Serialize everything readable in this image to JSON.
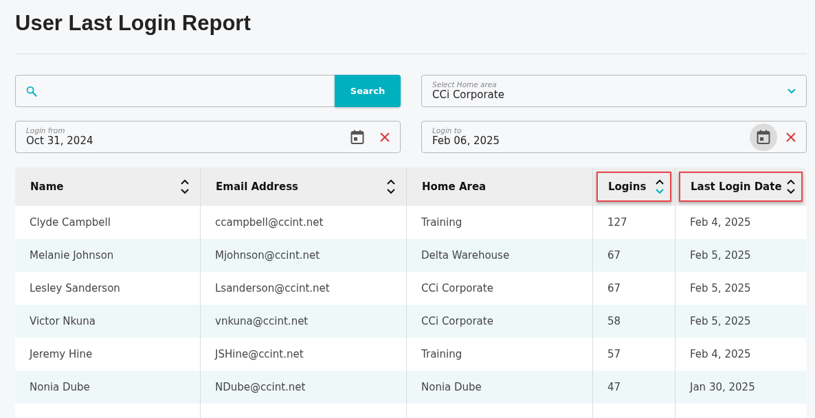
{
  "page": {
    "title": "User Last Login Report"
  },
  "search": {
    "button": "Search"
  },
  "home_area": {
    "label": "Select Home area",
    "value": "CCi Corporate"
  },
  "login_from": {
    "label": "Login from",
    "value": "Oct 31, 2024",
    "picker_active": false
  },
  "login_to": {
    "label": "Login to",
    "value": "Feb 06, 2025",
    "picker_active": true
  },
  "table": {
    "columns": [
      {
        "label": "Name",
        "sortable": true,
        "sort_descending": false,
        "highlighted": false
      },
      {
        "label": "Email Address",
        "sortable": true,
        "sort_descending": false,
        "highlighted": false
      },
      {
        "label": "Home Area",
        "sortable": false,
        "highlighted": false
      },
      {
        "label": "Logins",
        "sortable": true,
        "sort_descending": true,
        "highlighted": true
      },
      {
        "label": "Last Login Date",
        "sortable": true,
        "sort_descending": false,
        "highlighted": true
      }
    ],
    "rows": [
      [
        "Clyde Campbell",
        "ccampbell@ccint.net",
        "Training",
        "127",
        "Feb 4, 2025"
      ],
      [
        "Melanie Johnson",
        "Mjohnson@ccint.net",
        "Delta Warehouse",
        "67",
        "Feb 5, 2025"
      ],
      [
        "Lesley Sanderson",
        "Lsanderson@ccint.net",
        "CCi Corporate",
        "67",
        "Feb 5, 2025"
      ],
      [
        "Victor Nkuna",
        "vnkuna@ccint.net",
        "CCi Corporate",
        "58",
        "Feb 5, 2025"
      ],
      [
        "Jeremy Hine",
        "JSHine@ccint.net",
        "Training",
        "57",
        "Feb 4, 2025"
      ],
      [
        "Nonia Dube",
        "NDube@ccint.net",
        "Nonia Dube",
        "47",
        "Jan 30, 2025"
      ]
    ]
  }
}
